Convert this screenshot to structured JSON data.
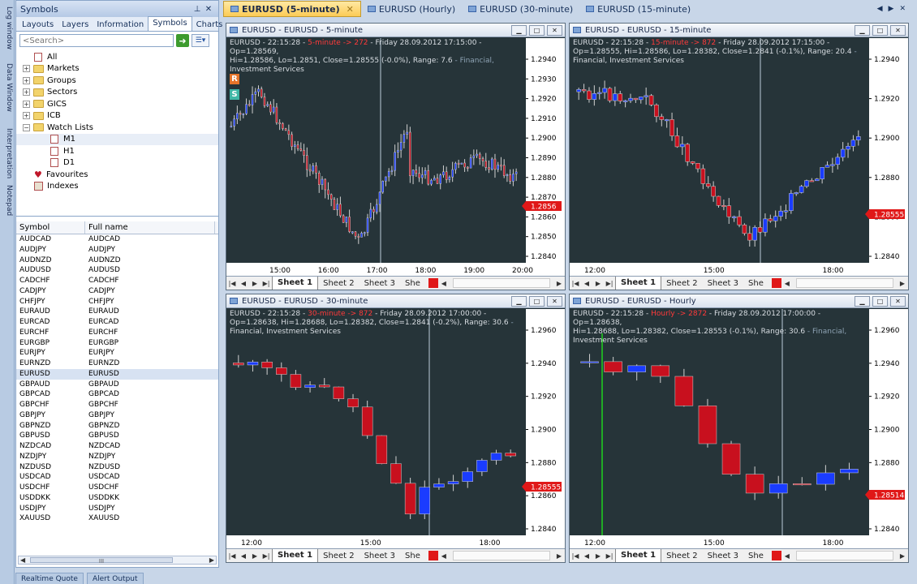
{
  "side_tabs": [
    "Log window",
    "Data Window",
    "Interpretation",
    "Notepad"
  ],
  "panel": {
    "title": "Symbols",
    "tabs": [
      "Layouts",
      "Layers",
      "Information",
      "Symbols",
      "Charts"
    ],
    "active_tab": "Symbols",
    "search_placeholder": "<Search>",
    "tree": [
      {
        "label": "All",
        "type": "doc",
        "level": 1
      },
      {
        "label": "Markets",
        "type": "folder",
        "level": 0
      },
      {
        "label": "Groups",
        "type": "folder",
        "level": 0
      },
      {
        "label": "Sectors",
        "type": "folder",
        "level": 0
      },
      {
        "label": "GICS",
        "type": "folder",
        "level": 0
      },
      {
        "label": "ICB",
        "type": "folder",
        "level": 0
      },
      {
        "label": "Watch Lists",
        "type": "folder-open",
        "level": 0
      },
      {
        "label": "M1",
        "type": "doc",
        "level": 2
      },
      {
        "label": "H1",
        "type": "doc",
        "level": 2
      },
      {
        "label": "D1",
        "type": "doc",
        "level": 2
      },
      {
        "label": "Favourites",
        "type": "heart",
        "level": 1
      },
      {
        "label": "Indexes",
        "type": "index",
        "level": 1
      }
    ],
    "columns": [
      "Symbol",
      "Full name"
    ],
    "symbols": [
      "AUDCAD",
      "AUDJPY",
      "AUDNZD",
      "AUDUSD",
      "CADCHF",
      "CADJPY",
      "CHFJPY",
      "EURAUD",
      "EURCAD",
      "EURCHF",
      "EURGBP",
      "EURJPY",
      "EURNZD",
      "EURUSD",
      "GBPAUD",
      "GBPCAD",
      "GBPCHF",
      "GBPJPY",
      "GBPNZD",
      "GBPUSD",
      "NZDCAD",
      "NZDJPY",
      "NZDUSD",
      "USDCAD",
      "USDCHF",
      "USDDKK",
      "USDJPY",
      "XAUUSD"
    ],
    "selected_symbol": "EURUSD",
    "scroll_thumb_label": "III"
  },
  "bottom_tabs": [
    "Realtime Quote",
    "Alert Output"
  ],
  "doc_tabs": [
    {
      "label": "EURUSD (5-minute)",
      "active": true
    },
    {
      "label": "EURUSD (Hourly)",
      "active": false
    },
    {
      "label": "EURUSD (30-minute)",
      "active": false
    },
    {
      "label": "EURUSD (15-minute)",
      "active": false
    }
  ],
  "sheets": [
    "Sheet 1",
    "Sheet 2",
    "Sheet 3",
    "She"
  ],
  "colors": {
    "bull": "#1a3cff",
    "bear": "#c8101e",
    "price_tag": "#e01818",
    "bg": "#253339"
  },
  "charts": [
    {
      "title": "EURUSD - EURUSD - 5-minute",
      "info_l1a": "EURUSD - 22:15:28 - ",
      "info_l1b": "5-minute -> 272",
      "info_l1c": " - Friday 28.09.2012 17:15:00 - Op=1.28569,",
      "info_l2a": "Hi=1.28586, Lo=1.2851, Close=1.28555 (-0.0%), Range: 7.6",
      "info_l2b": " - Financial,",
      "info_l3": "Investment Services",
      "price_tag": "1.2856",
      "y_labels": [
        "1.2940",
        "1.2930",
        "1.2920",
        "1.2910",
        "1.2900",
        "1.2890",
        "1.2880",
        "1.2870",
        "1.2860",
        "1.2850",
        "1.2840"
      ],
      "x_labels": [
        "15:00",
        "16:00",
        "17:00",
        "18:00",
        "19:00",
        "20:00"
      ],
      "rs": [
        "R",
        "S"
      ]
    },
    {
      "title": "EURUSD - EURUSD - 15-minute",
      "info_l1a": "EURUSD - 22:15:28 - ",
      "info_l1b": "15-minute -> 872",
      "info_l1c": " - Friday 28.09.2012 17:15:00 -",
      "info_l2a": "Op=1.28555, Hi=1.28586, Lo=1.28382, Close=1.2841 (-0.1%), Range: 20.4",
      "info_l2b": " -",
      "info_l3": "Financial, Investment Services",
      "price_tag": "1.28555",
      "y_labels": [
        "1.2940",
        "1.2920",
        "1.2900",
        "1.2880",
        "1.2860",
        "1.2840"
      ],
      "x_labels": [
        "12:00",
        "15:00",
        "18:00"
      ]
    },
    {
      "title": "EURUSD - EURUSD - 30-minute",
      "info_l1a": "EURUSD - 22:15:28 - ",
      "info_l1b": "30-minute -> 872",
      "info_l1c": " - Friday 28.09.2012 17:00:00 -",
      "info_l2a": "Op=1.28638, Hi=1.28688, Lo=1.28382, Close=1.2841 (-0.2%), Range: 30.6",
      "info_l2b": " -",
      "info_l3": "Financial, Investment Services",
      "price_tag": "1.28555",
      "y_labels": [
        "1.2960",
        "1.2940",
        "1.2920",
        "1.2900",
        "1.2880",
        "1.2860",
        "1.2840"
      ],
      "x_labels": [
        "12:00",
        "15:00",
        "18:00"
      ]
    },
    {
      "title": "EURUSD - EURUSD - Hourly",
      "info_l1a": "EURUSD - 22:15:28 - ",
      "info_l1b": "Hourly -> 2872",
      "info_l1c": " - Friday 28.09.2012 17:00:00 - Op=1.28638,",
      "info_l2a": "Hi=1.28688, Lo=1.28382, Close=1.28553 (-0.1%), Range: 30.6",
      "info_l2b": " - Financial,",
      "info_l3": "Investment Services",
      "price_tag": "1.28514",
      "y_labels": [
        "1.2960",
        "1.2940",
        "1.2920",
        "1.2900",
        "1.2880",
        "1.2860",
        "1.2840"
      ],
      "x_labels": [
        "12:00",
        "15:00",
        "18:00"
      ]
    }
  ]
}
